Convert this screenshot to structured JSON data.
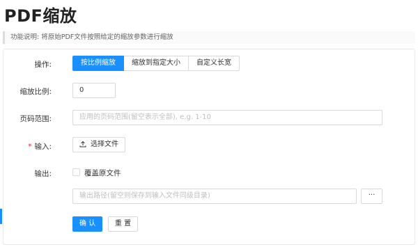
{
  "page": {
    "title": "PDF缩放",
    "description": "功能说明: 将原始PDF文件按照给定的缩放参数进行缩放"
  },
  "form": {
    "operation": {
      "label": "操作:",
      "options": [
        "按比例缩放",
        "缩放到指定大小",
        "自定义长宽"
      ],
      "selected": "按比例缩放"
    },
    "scale": {
      "label": "缩放比例:",
      "value": "0"
    },
    "page_range": {
      "label": "页码范围:",
      "placeholder": "应用的页码范围(留空表示全部), e.g. 1-10"
    },
    "input": {
      "required_mark": "*",
      "label": "输入:",
      "button_label": "选择文件"
    },
    "output": {
      "label": "输出:",
      "overwrite_label": "覆盖原文件",
      "overwrite_checked": false,
      "path_placeholder": "输出路径(留空则保存到输入文件同级目录)",
      "browse_label": "···"
    },
    "actions": {
      "confirm_label": "确 认",
      "reset_label": "重 置"
    }
  },
  "colors": {
    "primary": "#1890ff",
    "required": "#f5222d",
    "border": "#d9d9d9"
  }
}
